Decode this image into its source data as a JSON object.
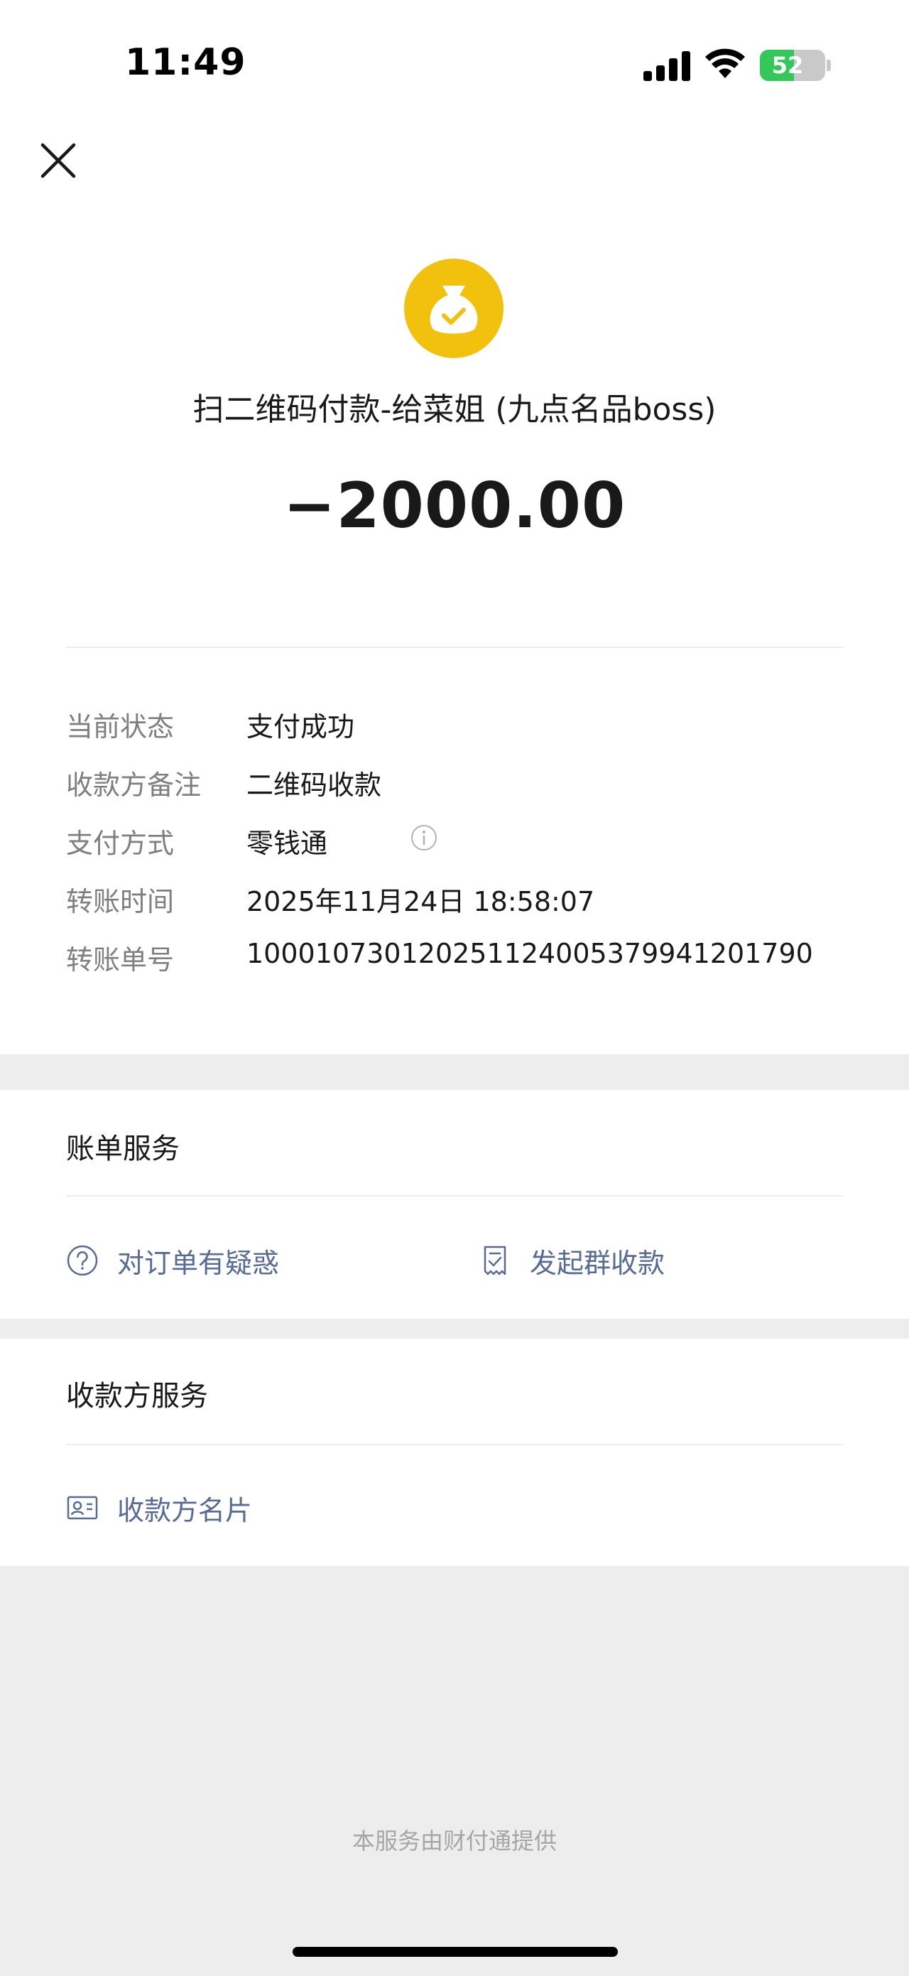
{
  "status_bar": {
    "time": "11:49",
    "battery_percent": "52",
    "battery_level": 0.52,
    "battery_color": "#34c759"
  },
  "header": {
    "close_icon": "close-icon"
  },
  "transaction": {
    "icon": "money-bag-check-icon",
    "icon_color": "#f2c10e",
    "title": "扫二维码付款-给菜姐 (九点名品boss)",
    "amount": "−2000.00"
  },
  "details": [
    {
      "label": "当前状态",
      "value": "支付成功"
    },
    {
      "label": "收款方备注",
      "value": "二维码收款"
    },
    {
      "label": "支付方式",
      "value": "零钱通",
      "info_icon": "info-icon"
    },
    {
      "label": "转账时间",
      "value": "2025年11月24日 18:58:07"
    },
    {
      "label": "转账单号",
      "value": "100010730120251124005379941201790"
    }
  ],
  "bill_service": {
    "title": "账单服务",
    "links": [
      {
        "label": "对订单有疑惑",
        "icon": "question-circle-icon"
      },
      {
        "label": "发起群收款",
        "icon": "receipt-icon"
      }
    ]
  },
  "payee_service": {
    "title": "收款方服务",
    "links": [
      {
        "label": "收款方名片",
        "icon": "contact-card-icon"
      }
    ]
  },
  "footer": {
    "text": "本服务由财付通提供"
  },
  "colors": {
    "link": "#576b95",
    "label": "#7f7f7f",
    "background": "#ededed"
  }
}
